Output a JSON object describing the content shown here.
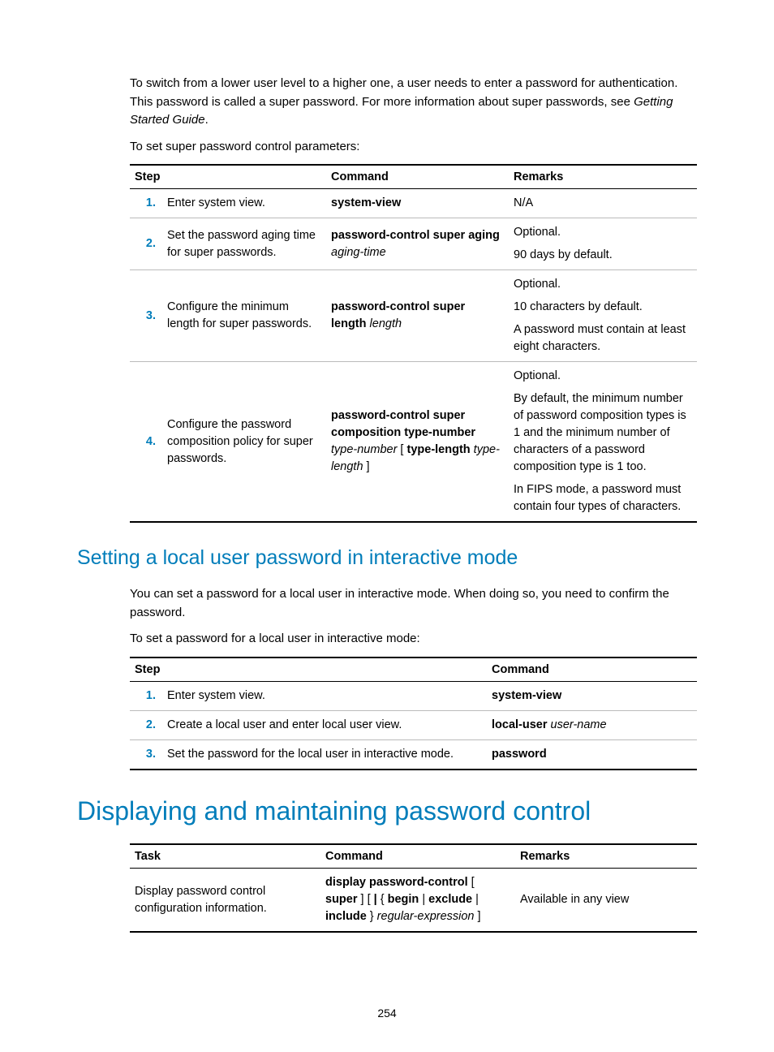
{
  "intro": {
    "text_a": "To switch from a lower user level to a higher one, a user needs to enter a password for authentication. This password is called a super password. For more information about super passwords, see ",
    "italic_ref": "Getting Started Guide",
    "text_b": ".",
    "lead": "To set super password control parameters:"
  },
  "table1": {
    "headers": {
      "step": "Step",
      "command": "Command",
      "remarks": "Remarks"
    },
    "rows": [
      {
        "num": "1.",
        "desc": "Enter system view.",
        "cmd_bold": "system-view",
        "cmd_italic": "",
        "remarks": [
          "N/A"
        ]
      },
      {
        "num": "2.",
        "desc": "Set the password aging time for super passwords.",
        "cmd_bold": "password-control super aging",
        "cmd_italic": "aging-time",
        "remarks": [
          "Optional.",
          "90 days by default."
        ]
      },
      {
        "num": "3.",
        "desc": "Configure the minimum length for super passwords.",
        "cmd_bold": "password-control super length",
        "cmd_italic": "length",
        "remarks": [
          "Optional.",
          "10 characters by default.",
          "A password must contain at least eight characters."
        ]
      },
      {
        "num": "4.",
        "desc": "Configure the password composition policy for super passwords.",
        "cmd_parts": {
          "b1": "password-control super composition type-number",
          "i1": "type-number",
          "plain1": " [ ",
          "b2": "type-length",
          "i2": "type-length",
          "plain2": " ]"
        },
        "remarks": [
          "Optional.",
          "By default, the minimum number of password composition types is 1 and the minimum number of characters of a password composition type is 1 too.",
          "In FIPS mode, a password must contain four types of characters."
        ]
      }
    ]
  },
  "h2": "Setting a local user password in interactive mode",
  "section2": {
    "p1": "You can set a password for a local user in interactive mode. When doing so, you need to confirm the password.",
    "lead": "To set a password for a local user in interactive mode:"
  },
  "table2": {
    "headers": {
      "step": "Step",
      "command": "Command"
    },
    "rows": [
      {
        "num": "1.",
        "desc": "Enter system view.",
        "cmd_bold": "system-view",
        "cmd_italic": ""
      },
      {
        "num": "2.",
        "desc": "Create a local user and enter local user view.",
        "cmd_bold": "local-user",
        "cmd_italic": "user-name"
      },
      {
        "num": "3.",
        "desc": "Set the password for the local user in interactive mode.",
        "cmd_bold": "password",
        "cmd_italic": ""
      }
    ]
  },
  "h1": "Displaying and maintaining password control",
  "table3": {
    "headers": {
      "task": "Task",
      "command": "Command",
      "remarks": "Remarks"
    },
    "row": {
      "task": "Display password control configuration information.",
      "cmd": {
        "b1": "display password-control",
        "plain1": " [ ",
        "b2": "super",
        "plain2": " ] [ ",
        "b3": "|",
        "plain3": " { ",
        "b4": "begin",
        "plain4": " | ",
        "b5": "exclude",
        "plain5": " | ",
        "b6": "include",
        "plain6": " } ",
        "i1": "regular-expression",
        "plain7": " ]"
      },
      "remarks": "Available in any view"
    }
  },
  "pagenum": "254"
}
